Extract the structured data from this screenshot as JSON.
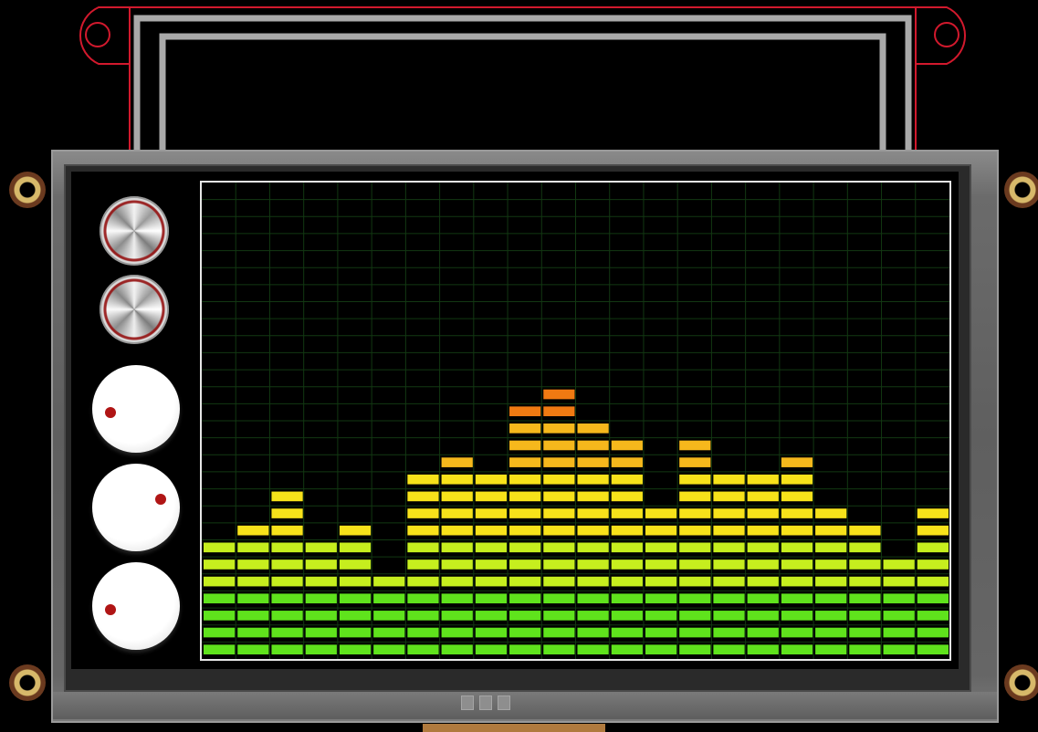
{
  "device": {
    "colors": {
      "pcb_outline": "#d2192d",
      "bezel_trace": "#a9a9a9",
      "grid_line": "#123812",
      "knob_indicator": "#b01515",
      "segment_green": "#5fe31c",
      "segment_yellow_green": "#c6ee1e",
      "segment_yellow": "#f7e21a",
      "segment_amber": "#f6b81c",
      "segment_orange": "#f07a12"
    }
  },
  "controls": {
    "metal_knobs": [
      {
        "name": "metal-knob-1"
      },
      {
        "name": "metal-knob-2"
      }
    ],
    "dial_knobs": [
      {
        "name": "dial-knob-1",
        "indicator": "left"
      },
      {
        "name": "dial-knob-2",
        "indicator": "right"
      },
      {
        "name": "dial-knob-3",
        "indicator": "left"
      }
    ]
  },
  "chart_data": {
    "type": "bar",
    "title": "",
    "xlabel": "",
    "ylabel": "",
    "grid": true,
    "levels_max": 28,
    "columns": 22,
    "values": [
      7,
      8,
      10,
      7,
      8,
      5,
      11,
      12,
      11,
      15,
      16,
      14,
      13,
      9,
      13,
      11,
      11,
      12,
      9,
      8,
      6,
      9
    ]
  }
}
